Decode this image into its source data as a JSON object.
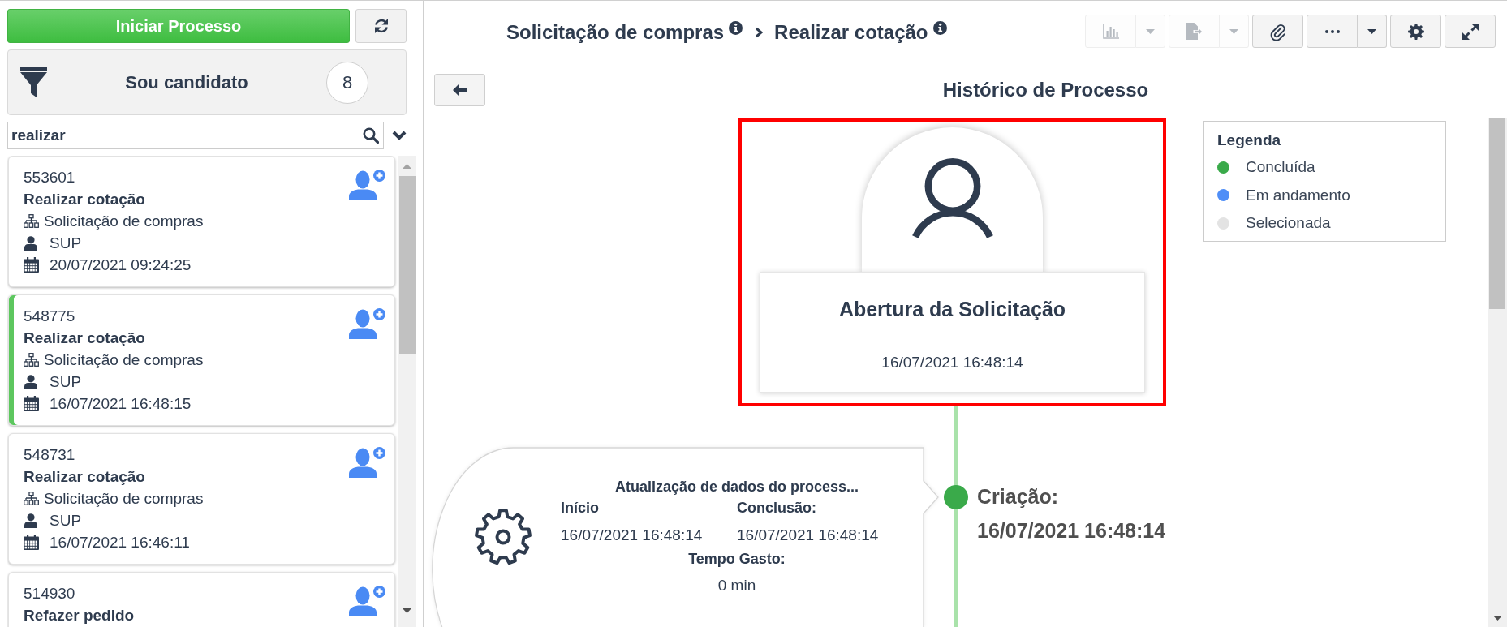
{
  "sidebar": {
    "start_button": "Iniciar Processo",
    "filter": {
      "label": "Sou candidato",
      "count": "8"
    },
    "search": {
      "value": "realizar"
    },
    "tasks": [
      {
        "id": "553601",
        "title": "Realizar cotação",
        "process": "Solicitação de compras",
        "user": "SUP",
        "date": "20/07/2021 09:24:25",
        "selected": false
      },
      {
        "id": "548775",
        "title": "Realizar cotação",
        "process": "Solicitação de compras",
        "user": "SUP",
        "date": "16/07/2021 16:48:15",
        "selected": true
      },
      {
        "id": "548731",
        "title": "Realizar cotação",
        "process": "Solicitação de compras",
        "user": "SUP",
        "date": "16/07/2021 16:46:11",
        "selected": false
      },
      {
        "id": "514930",
        "title": "Refazer pedido",
        "selected": false
      }
    ]
  },
  "header": {
    "breadcrumb": [
      {
        "label": "Solicitação de compras"
      },
      {
        "label": "Realizar cotação"
      }
    ],
    "toolbar": [
      {
        "kind": "chart",
        "disabled": true,
        "dropdown": true
      },
      {
        "kind": "export",
        "disabled": true,
        "dropdown": true
      },
      {
        "kind": "attach",
        "disabled": false,
        "dropdown": false
      },
      {
        "kind": "more",
        "disabled": false,
        "dropdown": true
      },
      {
        "kind": "settings",
        "disabled": false,
        "dropdown": false
      },
      {
        "kind": "expand",
        "disabled": false,
        "dropdown": false
      }
    ]
  },
  "history": {
    "title": "Histórico de Processo",
    "legend": {
      "title": "Legenda",
      "items": [
        {
          "label": "Concluída",
          "color": "#3aaa4a"
        },
        {
          "label": "Em andamento",
          "color": "#4f8ef7"
        },
        {
          "label": "Selecionada",
          "color": "#e3e3e3"
        }
      ]
    },
    "start_node": {
      "kind": "user",
      "title": "Abertura da Solicitação",
      "date": "16/07/2021 16:48:14",
      "selected": true
    },
    "timeline": [
      {
        "kind": "system",
        "title": "Atualização de dados do process...",
        "start_label": "Início",
        "start": "16/07/2021 16:48:14",
        "end_label": "Conclusão:",
        "end": "16/07/2021 16:48:14",
        "duration_label": "Tempo Gasto:",
        "duration": "0 min",
        "color": "#3aaa4a",
        "event_label": "Criação:",
        "event_date": "16/07/2021 16:48:14"
      }
    ]
  }
}
